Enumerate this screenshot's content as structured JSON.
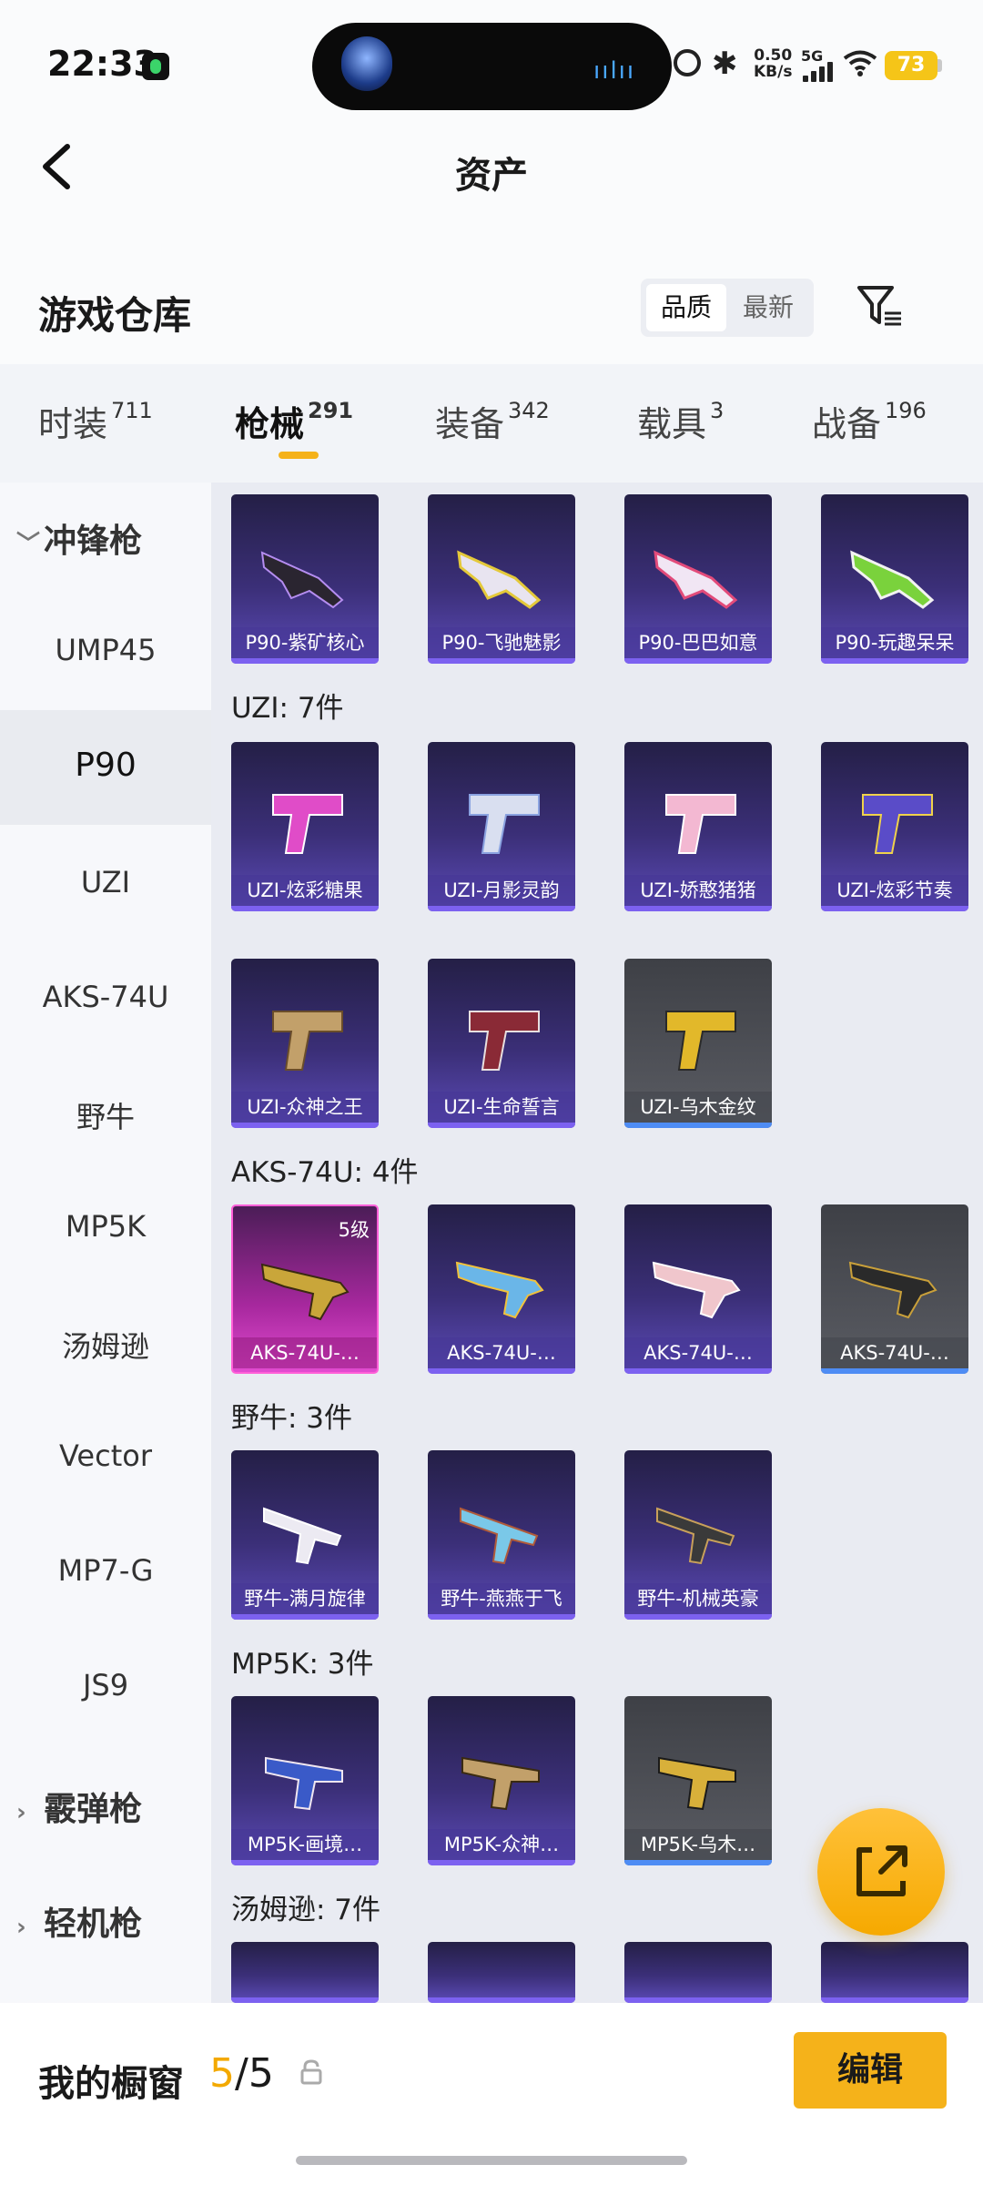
{
  "status_bar": {
    "time": "22:33",
    "net_speed": "0.50",
    "net_unit": "KB/s",
    "network": "5G",
    "battery": "73",
    "wave": "ıılıı"
  },
  "header": {
    "title": "资产"
  },
  "warehouse": {
    "title": "游戏仓库",
    "sort_quality": "品质",
    "sort_newest": "最新"
  },
  "tabs": [
    {
      "label": "时装",
      "count": "711"
    },
    {
      "label": "枪械",
      "count": "291"
    },
    {
      "label": "装备",
      "count": "342"
    },
    {
      "label": "载具",
      "count": "3"
    },
    {
      "label": "战备",
      "count": "196"
    }
  ],
  "sidebar": {
    "group_smg": "冲锋枪",
    "items": [
      "UMP45",
      "P90",
      "UZI",
      "AKS-74U",
      "野牛",
      "MP5K",
      "汤姆逊",
      "Vector",
      "MP7-G",
      "JS9"
    ],
    "group_shotgun": "霰弹枪",
    "group_lmg": "轻机枪"
  },
  "sections": {
    "p90": {
      "items": [
        "P90-紫矿核心",
        "P90-飞驰魅影",
        "P90-巴巴如意",
        "P90-玩趣呆呆"
      ]
    },
    "uzi": {
      "title": "UZI: 7件",
      "items": [
        "UZI-炫彩糖果",
        "UZI-月影灵韵",
        "UZI-娇憨猪猪",
        "UZI-炫彩节奏",
        "UZI-众神之王",
        "UZI-生命誓言",
        "UZI-乌木金纹"
      ]
    },
    "aks": {
      "title": "AKS-74U: 4件",
      "items": [
        "AKS-74U-…",
        "AKS-74U-…",
        "AKS-74U-…",
        "AKS-74U-…"
      ],
      "level_badge": "5级"
    },
    "bizon": {
      "title": "野牛: 3件",
      "items": [
        "野牛-满月旋律",
        "野牛-燕燕于飞",
        "野牛-机械英豪"
      ]
    },
    "mp5k": {
      "title": "MP5K: 3件",
      "items": [
        "MP5K-画境…",
        "MP5K-众神…",
        "MP5K-乌木…"
      ]
    },
    "thompson": {
      "title": "汤姆逊: 7件"
    }
  },
  "bottom": {
    "showcase_label": "我的橱窗",
    "showcase_current": "5",
    "showcase_total": "/5",
    "edit_label": "编辑"
  },
  "colors": {
    "accent": "#f5b21a",
    "card_purple": "#3b2f78",
    "card_gray": "#5a5c63",
    "card_pink": "#a7289e"
  }
}
